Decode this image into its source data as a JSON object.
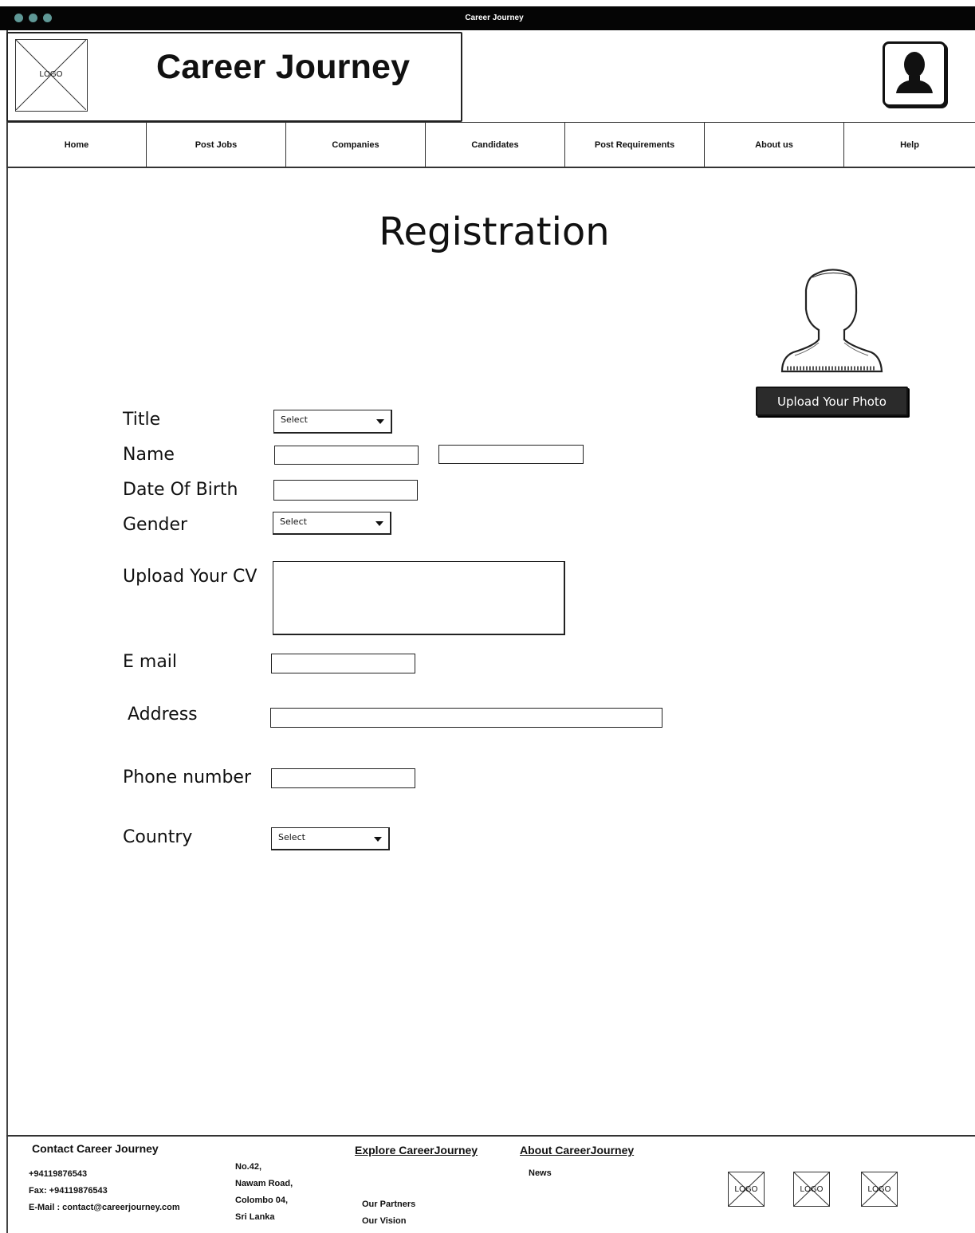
{
  "window": {
    "title": "Career Journey"
  },
  "header": {
    "logo_label": "LOGO",
    "site_title": "Career Journey"
  },
  "nav": [
    {
      "label": "Home"
    },
    {
      "label": "Post Jobs"
    },
    {
      "label": "Companies"
    },
    {
      "label": "Candidates"
    },
    {
      "label": "Post Requirements"
    },
    {
      "label": "About us"
    },
    {
      "label": "Help"
    }
  ],
  "page": {
    "title": "Registration",
    "upload_photo_label": "Upload Your Photo"
  },
  "form": {
    "title_label": "Title",
    "title_select": "Select",
    "name_label": "Name",
    "dob_label": "Date Of Birth",
    "gender_label": "Gender",
    "gender_select": "Select",
    "cv_label": "Upload Your CV",
    "email_label": "E mail",
    "address_label": "Address",
    "phone_label": "Phone number",
    "country_label": "Country",
    "country_select": "Select"
  },
  "footer": {
    "contact_heading": "Contact Career Journey",
    "phone": "+94119876543",
    "fax": "Fax: +94119876543",
    "email": "E-Mail : contact@careerjourney.com",
    "address_line1": "No.42,",
    "address_line2": "Nawam Road,",
    "address_line3": "Colombo 04,",
    "address_line4": "Sri Lanka",
    "explore_heading": "Explore CareerJourney",
    "our_partners": "Our Partners",
    "our_vision": "Our Vision",
    "about_heading": "About CareerJourney",
    "news": "News",
    "logo_label": "LOGO"
  }
}
